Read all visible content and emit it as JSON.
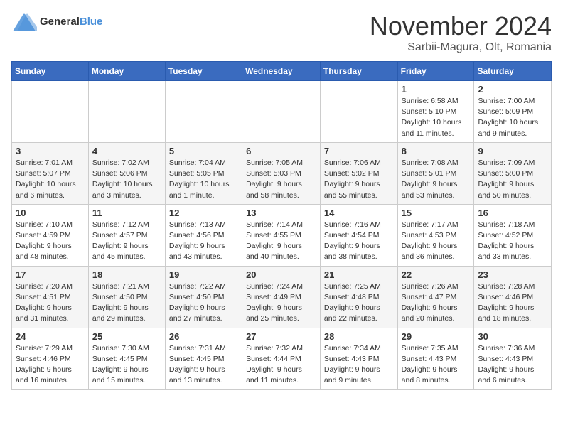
{
  "logo": {
    "text_general": "General",
    "text_blue": "Blue"
  },
  "title": "November 2024",
  "location": "Sarbii-Magura, Olt, Romania",
  "days_of_week": [
    "Sunday",
    "Monday",
    "Tuesday",
    "Wednesday",
    "Thursday",
    "Friday",
    "Saturday"
  ],
  "weeks": [
    [
      {
        "day": "",
        "info": ""
      },
      {
        "day": "",
        "info": ""
      },
      {
        "day": "",
        "info": ""
      },
      {
        "day": "",
        "info": ""
      },
      {
        "day": "",
        "info": ""
      },
      {
        "day": "1",
        "info": "Sunrise: 6:58 AM\nSunset: 5:10 PM\nDaylight: 10 hours and 11 minutes."
      },
      {
        "day": "2",
        "info": "Sunrise: 7:00 AM\nSunset: 5:09 PM\nDaylight: 10 hours and 9 minutes."
      }
    ],
    [
      {
        "day": "3",
        "info": "Sunrise: 7:01 AM\nSunset: 5:07 PM\nDaylight: 10 hours and 6 minutes."
      },
      {
        "day": "4",
        "info": "Sunrise: 7:02 AM\nSunset: 5:06 PM\nDaylight: 10 hours and 3 minutes."
      },
      {
        "day": "5",
        "info": "Sunrise: 7:04 AM\nSunset: 5:05 PM\nDaylight: 10 hours and 1 minute."
      },
      {
        "day": "6",
        "info": "Sunrise: 7:05 AM\nSunset: 5:03 PM\nDaylight: 9 hours and 58 minutes."
      },
      {
        "day": "7",
        "info": "Sunrise: 7:06 AM\nSunset: 5:02 PM\nDaylight: 9 hours and 55 minutes."
      },
      {
        "day": "8",
        "info": "Sunrise: 7:08 AM\nSunset: 5:01 PM\nDaylight: 9 hours and 53 minutes."
      },
      {
        "day": "9",
        "info": "Sunrise: 7:09 AM\nSunset: 5:00 PM\nDaylight: 9 hours and 50 minutes."
      }
    ],
    [
      {
        "day": "10",
        "info": "Sunrise: 7:10 AM\nSunset: 4:59 PM\nDaylight: 9 hours and 48 minutes."
      },
      {
        "day": "11",
        "info": "Sunrise: 7:12 AM\nSunset: 4:57 PM\nDaylight: 9 hours and 45 minutes."
      },
      {
        "day": "12",
        "info": "Sunrise: 7:13 AM\nSunset: 4:56 PM\nDaylight: 9 hours and 43 minutes."
      },
      {
        "day": "13",
        "info": "Sunrise: 7:14 AM\nSunset: 4:55 PM\nDaylight: 9 hours and 40 minutes."
      },
      {
        "day": "14",
        "info": "Sunrise: 7:16 AM\nSunset: 4:54 PM\nDaylight: 9 hours and 38 minutes."
      },
      {
        "day": "15",
        "info": "Sunrise: 7:17 AM\nSunset: 4:53 PM\nDaylight: 9 hours and 36 minutes."
      },
      {
        "day": "16",
        "info": "Sunrise: 7:18 AM\nSunset: 4:52 PM\nDaylight: 9 hours and 33 minutes."
      }
    ],
    [
      {
        "day": "17",
        "info": "Sunrise: 7:20 AM\nSunset: 4:51 PM\nDaylight: 9 hours and 31 minutes."
      },
      {
        "day": "18",
        "info": "Sunrise: 7:21 AM\nSunset: 4:50 PM\nDaylight: 9 hours and 29 minutes."
      },
      {
        "day": "19",
        "info": "Sunrise: 7:22 AM\nSunset: 4:50 PM\nDaylight: 9 hours and 27 minutes."
      },
      {
        "day": "20",
        "info": "Sunrise: 7:24 AM\nSunset: 4:49 PM\nDaylight: 9 hours and 25 minutes."
      },
      {
        "day": "21",
        "info": "Sunrise: 7:25 AM\nSunset: 4:48 PM\nDaylight: 9 hours and 22 minutes."
      },
      {
        "day": "22",
        "info": "Sunrise: 7:26 AM\nSunset: 4:47 PM\nDaylight: 9 hours and 20 minutes."
      },
      {
        "day": "23",
        "info": "Sunrise: 7:28 AM\nSunset: 4:46 PM\nDaylight: 9 hours and 18 minutes."
      }
    ],
    [
      {
        "day": "24",
        "info": "Sunrise: 7:29 AM\nSunset: 4:46 PM\nDaylight: 9 hours and 16 minutes."
      },
      {
        "day": "25",
        "info": "Sunrise: 7:30 AM\nSunset: 4:45 PM\nDaylight: 9 hours and 15 minutes."
      },
      {
        "day": "26",
        "info": "Sunrise: 7:31 AM\nSunset: 4:45 PM\nDaylight: 9 hours and 13 minutes."
      },
      {
        "day": "27",
        "info": "Sunrise: 7:32 AM\nSunset: 4:44 PM\nDaylight: 9 hours and 11 minutes."
      },
      {
        "day": "28",
        "info": "Sunrise: 7:34 AM\nSunset: 4:43 PM\nDaylight: 9 hours and 9 minutes."
      },
      {
        "day": "29",
        "info": "Sunrise: 7:35 AM\nSunset: 4:43 PM\nDaylight: 9 hours and 8 minutes."
      },
      {
        "day": "30",
        "info": "Sunrise: 7:36 AM\nSunset: 4:43 PM\nDaylight: 9 hours and 6 minutes."
      }
    ]
  ]
}
